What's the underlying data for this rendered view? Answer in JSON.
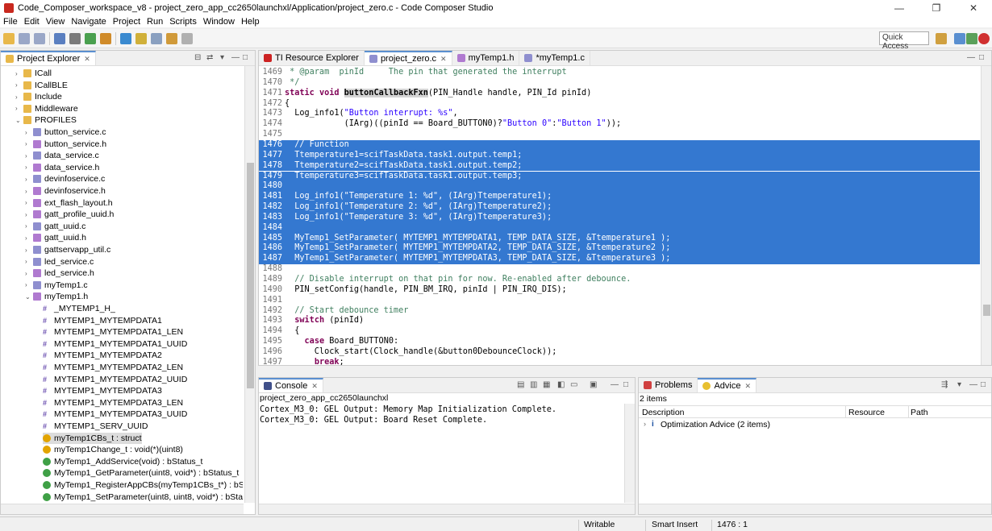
{
  "window": {
    "title": "Code_Composer_workspace_v8 - project_zero_app_cc2650launchxl/Application/project_zero.c - Code Composer Studio",
    "minimize": "—",
    "maximize": "❐",
    "close": "✕"
  },
  "menu": [
    "File",
    "Edit",
    "View",
    "Navigate",
    "Project",
    "Run",
    "Scripts",
    "Window",
    "Help"
  ],
  "toolbar": {
    "quick_access": "Quick Access"
  },
  "explorer": {
    "tab_label": "Project Explorer",
    "items": [
      {
        "label": "ICall",
        "kind": "folder",
        "depth": 1,
        "arrow": "›"
      },
      {
        "label": "ICallBLE",
        "kind": "folder",
        "depth": 1,
        "arrow": "›"
      },
      {
        "label": "Include",
        "kind": "folder",
        "depth": 1,
        "arrow": "›"
      },
      {
        "label": "Middleware",
        "kind": "folder",
        "depth": 1,
        "arrow": "›"
      },
      {
        "label": "PROFILES",
        "kind": "folder",
        "depth": 1,
        "arrow": "⌄"
      },
      {
        "label": "button_service.c",
        "kind": "c",
        "depth": 2,
        "arrow": "›"
      },
      {
        "label": "button_service.h",
        "kind": "h",
        "depth": 2,
        "arrow": "›"
      },
      {
        "label": "data_service.c",
        "kind": "c",
        "depth": 2,
        "arrow": "›"
      },
      {
        "label": "data_service.h",
        "kind": "h",
        "depth": 2,
        "arrow": "›"
      },
      {
        "label": "devinfoservice.c",
        "kind": "c",
        "depth": 2,
        "arrow": "›"
      },
      {
        "label": "devinfoservice.h",
        "kind": "h",
        "depth": 2,
        "arrow": "›"
      },
      {
        "label": "ext_flash_layout.h",
        "kind": "h",
        "depth": 2,
        "arrow": "›"
      },
      {
        "label": "gatt_profile_uuid.h",
        "kind": "h",
        "depth": 2,
        "arrow": "›"
      },
      {
        "label": "gatt_uuid.c",
        "kind": "c",
        "depth": 2,
        "arrow": "›"
      },
      {
        "label": "gatt_uuid.h",
        "kind": "h",
        "depth": 2,
        "arrow": "›"
      },
      {
        "label": "gattservapp_util.c",
        "kind": "c",
        "depth": 2,
        "arrow": "›"
      },
      {
        "label": "led_service.c",
        "kind": "c",
        "depth": 2,
        "arrow": "›"
      },
      {
        "label": "led_service.h",
        "kind": "h",
        "depth": 2,
        "arrow": "›"
      },
      {
        "label": "myTemp1.c",
        "kind": "c",
        "depth": 2,
        "arrow": "›"
      },
      {
        "label": "myTemp1.h",
        "kind": "h",
        "depth": 2,
        "arrow": "⌄"
      },
      {
        "label": "_MYTEMP1_H_",
        "kind": "macro",
        "depth": 3,
        "arrow": ""
      },
      {
        "label": "MYTEMP1_MYTEMPDATA1",
        "kind": "macro",
        "depth": 3,
        "arrow": ""
      },
      {
        "label": "MYTEMP1_MYTEMPDATA1_LEN",
        "kind": "macro",
        "depth": 3,
        "arrow": ""
      },
      {
        "label": "MYTEMP1_MYTEMPDATA1_UUID",
        "kind": "macro",
        "depth": 3,
        "arrow": ""
      },
      {
        "label": "MYTEMP1_MYTEMPDATA2",
        "kind": "macro",
        "depth": 3,
        "arrow": ""
      },
      {
        "label": "MYTEMP1_MYTEMPDATA2_LEN",
        "kind": "macro",
        "depth": 3,
        "arrow": ""
      },
      {
        "label": "MYTEMP1_MYTEMPDATA2_UUID",
        "kind": "macro",
        "depth": 3,
        "arrow": ""
      },
      {
        "label": "MYTEMP1_MYTEMPDATA3",
        "kind": "macro",
        "depth": 3,
        "arrow": ""
      },
      {
        "label": "MYTEMP1_MYTEMPDATA3_LEN",
        "kind": "macro",
        "depth": 3,
        "arrow": ""
      },
      {
        "label": "MYTEMP1_MYTEMPDATA3_UUID",
        "kind": "macro",
        "depth": 3,
        "arrow": ""
      },
      {
        "label": "MYTEMP1_SERV_UUID",
        "kind": "macro",
        "depth": 3,
        "arrow": ""
      },
      {
        "label": "myTemp1CBs_t : struct",
        "kind": "struct",
        "depth": 3,
        "arrow": "",
        "selected": true
      },
      {
        "label": "myTemp1Change_t : void(*)(uint8)",
        "kind": "struct",
        "depth": 3,
        "arrow": ""
      },
      {
        "label": "MyTemp1_AddService(void) : bStatus_t",
        "kind": "func",
        "depth": 3,
        "arrow": ""
      },
      {
        "label": "MyTemp1_GetParameter(uint8, void*) : bStatus_t",
        "kind": "func",
        "depth": 3,
        "arrow": ""
      },
      {
        "label": "MyTemp1_RegisterAppCBs(myTemp1CBs_t*) : bStatus_t",
        "kind": "func",
        "depth": 3,
        "arrow": ""
      },
      {
        "label": "MyTemp1_SetParameter(uint8, uint8, void*) : bStatus_t",
        "kind": "func",
        "depth": 3,
        "arrow": ""
      }
    ]
  },
  "editor": {
    "tabs": [
      {
        "label": "TI Resource Explorer",
        "active": false,
        "icon_color": "#cc2222"
      },
      {
        "label": "project_zero.c",
        "active": true,
        "icon_color": "#8f8fcf"
      },
      {
        "label": "myTemp1.h",
        "active": false,
        "icon_color": "#b07ad0"
      },
      {
        "label": "*myTemp1.c",
        "active": false,
        "icon_color": "#8f8fcf"
      }
    ],
    "lines": [
      {
        "n": "1469",
        "t": " * @param  pinId     The pin that generated the interrupt",
        "s": false,
        "k": "cm"
      },
      {
        "n": "1470",
        "t": " */",
        "s": false,
        "k": "cm"
      },
      {
        "n": "1471",
        "t": "static void buttonCallbackFxn(PIN_Handle handle, PIN_Id pinId)",
        "s": false,
        "k": "fn"
      },
      {
        "n": "1472",
        "t": "{",
        "s": false,
        "k": ""
      },
      {
        "n": "1473",
        "t": "  Log_info1(\"Button interrupt: %s\",",
        "s": false,
        "k": "str"
      },
      {
        "n": "1474",
        "t": "            (IArg)((pinId == Board_BUTTON0)?\"Button 0\":\"Button 1\"));",
        "s": false,
        "k": "str"
      },
      {
        "n": "1475",
        "t": "",
        "s": false,
        "k": ""
      },
      {
        "n": "1476",
        "t": "  // Function",
        "s": true,
        "k": ""
      },
      {
        "n": "1477",
        "t": "  Ttemperature1=scifTaskData.task1.output.temp1;",
        "s": true,
        "k": ""
      },
      {
        "n": "1478",
        "t": "  Ttemperature2=scifTaskData.task1.output.temp2;",
        "s": true,
        "k": ""
      },
      {
        "n": "1479",
        "t": "  Ttemperature3=scifTaskData.task1.output.temp3;",
        "s": true,
        "k": ""
      },
      {
        "n": "1480",
        "t": "",
        "s": true,
        "k": ""
      },
      {
        "n": "1481",
        "t": "  Log_info1(\"Temperature 1: %d\", (IArg)Ttemperature1);",
        "s": true,
        "k": ""
      },
      {
        "n": "1482",
        "t": "  Log_info1(\"Temperature 2: %d\", (IArg)Ttemperature2);",
        "s": true,
        "k": ""
      },
      {
        "n": "1483",
        "t": "  Log_info1(\"Temperature 3: %d\", (IArg)Ttemperature3);",
        "s": true,
        "k": ""
      },
      {
        "n": "1484",
        "t": "",
        "s": true,
        "k": ""
      },
      {
        "n": "1485",
        "t": "  MyTemp1_SetParameter( MYTEMP1_MYTEMPDATA1, TEMP_DATA_SIZE, &Ttemperature1 );",
        "s": true,
        "k": ""
      },
      {
        "n": "1486",
        "t": "  MyTemp1_SetParameter( MYTEMP1_MYTEMPDATA2, TEMP_DATA_SIZE, &Ttemperature2 );",
        "s": true,
        "k": ""
      },
      {
        "n": "1487",
        "t": "  MyTemp1_SetParameter( MYTEMP1_MYTEMPDATA3, TEMP_DATA_SIZE, &Ttemperature3 );",
        "s": true,
        "k": ""
      },
      {
        "n": "1488",
        "t": "",
        "s": false,
        "k": ""
      },
      {
        "n": "1489",
        "t": "  // Disable interrupt on that pin for now. Re-enabled after debounce.",
        "s": false,
        "k": "cm"
      },
      {
        "n": "1490",
        "t": "  PIN_setConfig(handle, PIN_BM_IRQ, pinId | PIN_IRQ_DIS);",
        "s": false,
        "k": ""
      },
      {
        "n": "1491",
        "t": "",
        "s": false,
        "k": ""
      },
      {
        "n": "1492",
        "t": "  // Start debounce timer",
        "s": false,
        "k": "cm"
      },
      {
        "n": "1493",
        "t": "  switch (pinId)",
        "s": false,
        "k": "sw"
      },
      {
        "n": "1494",
        "t": "  {",
        "s": false,
        "k": ""
      },
      {
        "n": "1495",
        "t": "    case Board_BUTTON0:",
        "s": false,
        "k": "case"
      },
      {
        "n": "1496",
        "t": "      Clock_start(Clock_handle(&button0DebounceClock));",
        "s": false,
        "k": ""
      },
      {
        "n": "1497",
        "t": "      break;",
        "s": false,
        "k": "brk"
      }
    ]
  },
  "console": {
    "tab_label": "Console",
    "header": "project_zero_app_cc2650launchxl",
    "lines": [
      "Cortex_M3_0: GEL Output: Memory Map Initialization Complete.",
      "Cortex_M3_0: GEL Output: Board Reset Complete."
    ]
  },
  "problems": {
    "tab_problems": "Problems",
    "tab_advice": "Advice",
    "count": "2 items",
    "columns": [
      "Description",
      "Resource",
      "Path"
    ],
    "rows": [
      {
        "description": "Optimization Advice (2 items)"
      }
    ]
  },
  "status": {
    "writable": "Writable",
    "insert_mode": "Smart Insert",
    "position": "1476 : 1"
  }
}
